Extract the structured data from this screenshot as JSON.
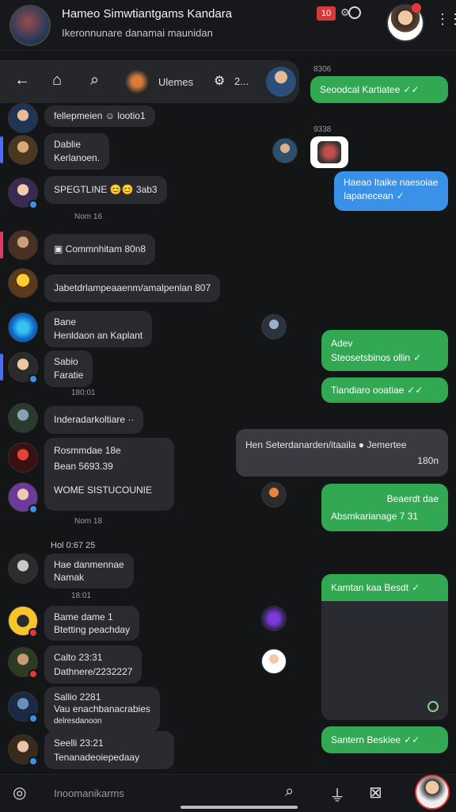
{
  "header": {
    "title": "Hameo Simwtiantgams Kandara",
    "subtitle": "Ikeronnunare danamai maunidan",
    "badge_text": "10",
    "kebab_icon": "vertical-dots-icon"
  },
  "toolbar": {
    "label": "Ulemes",
    "count": "2..."
  },
  "messages_left": [
    {
      "id": "m1",
      "text": "fellepmeien ☺ lootio1",
      "time": ""
    },
    {
      "id": "m2",
      "line1": "Dablie",
      "line2": "Kerlanoen.",
      "time": ""
    },
    {
      "id": "m3",
      "text": "SPEGTLINE 😊😊 3ab3",
      "time": ""
    },
    {
      "id": "t1",
      "time": "Nom 16"
    },
    {
      "id": "m4",
      "text": "Commnhitam",
      "extra": "80n8",
      "time": ""
    },
    {
      "id": "m5",
      "text": "Jabetdrlampeaaenm/amalpenlan",
      "extra": "807",
      "time": ""
    },
    {
      "id": "m6",
      "line1": "Bane",
      "line2": "Henldaon an Kaplant",
      "time": ""
    },
    {
      "id": "m7",
      "line1": "Sabio",
      "line2": "Faratie",
      "time": ""
    },
    {
      "id": "t2",
      "time": "180:01"
    },
    {
      "id": "m8",
      "text": "Inderadarkoltiare",
      "time": ""
    },
    {
      "id": "m9",
      "line1": "Rosmmdae 18e",
      "line2": "Bean 5693.39",
      "time": ""
    },
    {
      "id": "m10",
      "text": "WOME SISTUCOUNIE",
      "time": ""
    },
    {
      "id": "t3",
      "time": "Nom 18"
    },
    {
      "id": "sec",
      "time": "Hol 0:67 25"
    },
    {
      "id": "m11",
      "line1": "Hae danmennae",
      "line2": "Namak",
      "time": ""
    },
    {
      "id": "t4",
      "time": "18:01"
    },
    {
      "id": "m12",
      "line1": "Bame dame 1",
      "line2": "Btetting peachday",
      "time": ""
    },
    {
      "id": "m13",
      "line1": "Calto 23:31",
      "line2": "Dathnere/2232227",
      "time": ""
    },
    {
      "id": "m14",
      "line1": "Sallio 2281",
      "line2": "Vau enachbanacrabies",
      "line3": "delresdanoon",
      "time": ""
    },
    {
      "id": "m15",
      "line1": "Seelli 23:21",
      "line2": "Tenanadeoiepedaay",
      "time": ""
    }
  ],
  "messages_right": [
    {
      "id": "r0",
      "time": "8306"
    },
    {
      "id": "r1",
      "text": "Seoodcal Kartiatee"
    },
    {
      "id": "r2",
      "time": "9338"
    },
    {
      "id": "r3",
      "line1": "Haeao Itaike naesoiae",
      "line2": "Iapanecean"
    },
    {
      "id": "r4",
      "line1": "Adev",
      "line2": "Steosetsbinos ollin"
    },
    {
      "id": "r5",
      "text": "Tiandiaro ooatiae"
    },
    {
      "id": "r6",
      "line1": "Hen Seterdanarden/itaaila",
      "line1b": "Jemertee",
      "line2": "180n"
    },
    {
      "id": "r7",
      "line1": "Beaerdt dae",
      "line2": "Absmkarianage 7 31"
    },
    {
      "id": "r8",
      "text": "Kamtan kaa Besdt"
    },
    {
      "id": "r9",
      "text": "Santern Beskiee"
    }
  ],
  "composer": {
    "placeholder": "Inoomanikarms"
  }
}
